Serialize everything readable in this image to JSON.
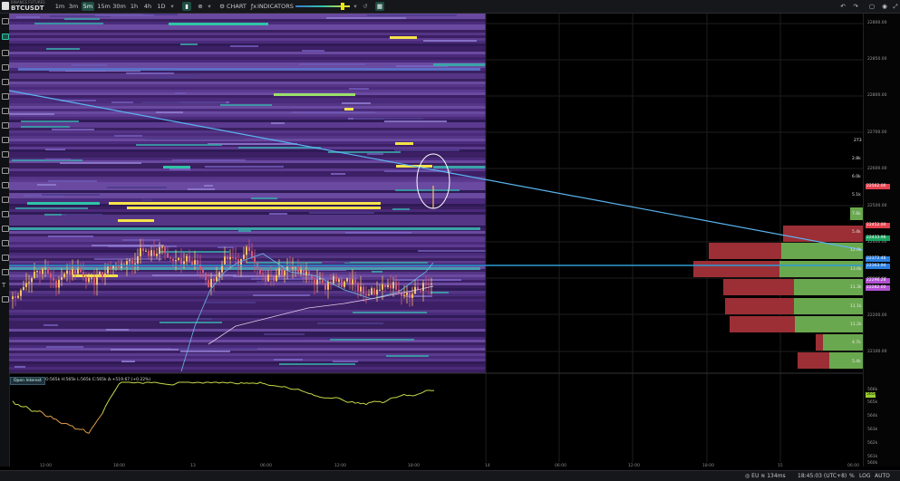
{
  "toolbar": {
    "exchange": "BINANCE FUTURES",
    "symbol": "BTCUSDT",
    "timeframes": [
      "1m",
      "3m",
      "5m",
      "15m",
      "30m",
      "1h",
      "4h",
      "1D"
    ],
    "active_timeframe": "5m",
    "chart_label": "CHART",
    "indicators_label": "INDICATORS"
  },
  "price_axis": {
    "labels": [
      "22800.00",
      "22850.00",
      "22800.00",
      "22700.00",
      "22600.00",
      "22500.00",
      "22400.00",
      "22300.00",
      "22200.00",
      "22100.00"
    ],
    "tags": [
      {
        "text": "22562.00",
        "color": "#e3424e"
      },
      {
        "text": "22452.00",
        "color": "#e3424e"
      },
      {
        "text": "22433.96",
        "color": "#1aa35f"
      },
      {
        "text": "22372.46",
        "color": "#2a7ee0"
      },
      {
        "text": "22363.94",
        "color": "#2a7ee0"
      },
      {
        "text": "22296.28",
        "color": "#b050d0"
      },
      {
        "text": "22282.00",
        "color": "#b050d0"
      }
    ]
  },
  "volume_labels": [
    "273",
    "2.8k",
    "6.0k",
    "5.1k",
    "7.6k",
    "5.4k",
    "12.0k",
    "13.6k",
    "11.3k",
    "11.1k",
    "11.2k",
    "4.7k",
    "5.4k"
  ],
  "oscillator": {
    "title": "Open Interest",
    "stats": "O:565k  H:565k  L:565k  C:565k  Δ:+519.67 (+0.22%)",
    "axis": [
      "566k",
      "565k",
      "564k",
      "563k",
      "562k",
      "561k",
      "560k",
      "559k"
    ],
    "current": "565k"
  },
  "time_axis": [
    "12:00",
    "18:00",
    "13",
    "06:00",
    "12:00",
    "18:00",
    "14",
    "06:00",
    "12:00",
    "18:00",
    "15",
    "06:00"
  ],
  "status": {
    "region": "EU",
    "latency": "134ms",
    "clock": "18:45:03 (UTC+8)",
    "percent": "%",
    "log": "LOG",
    "auto": "AUTO"
  },
  "colors": {
    "accent": "#2ec4a6",
    "bid": "#6aa84f",
    "ask": "#9b2f35",
    "candle_up": "#f6c066",
    "candle_down": "#d0587a",
    "level_line": "#2d9ad6",
    "trend_line": "#5ab4f0",
    "liquidity_hi": "#f5e34a"
  }
}
